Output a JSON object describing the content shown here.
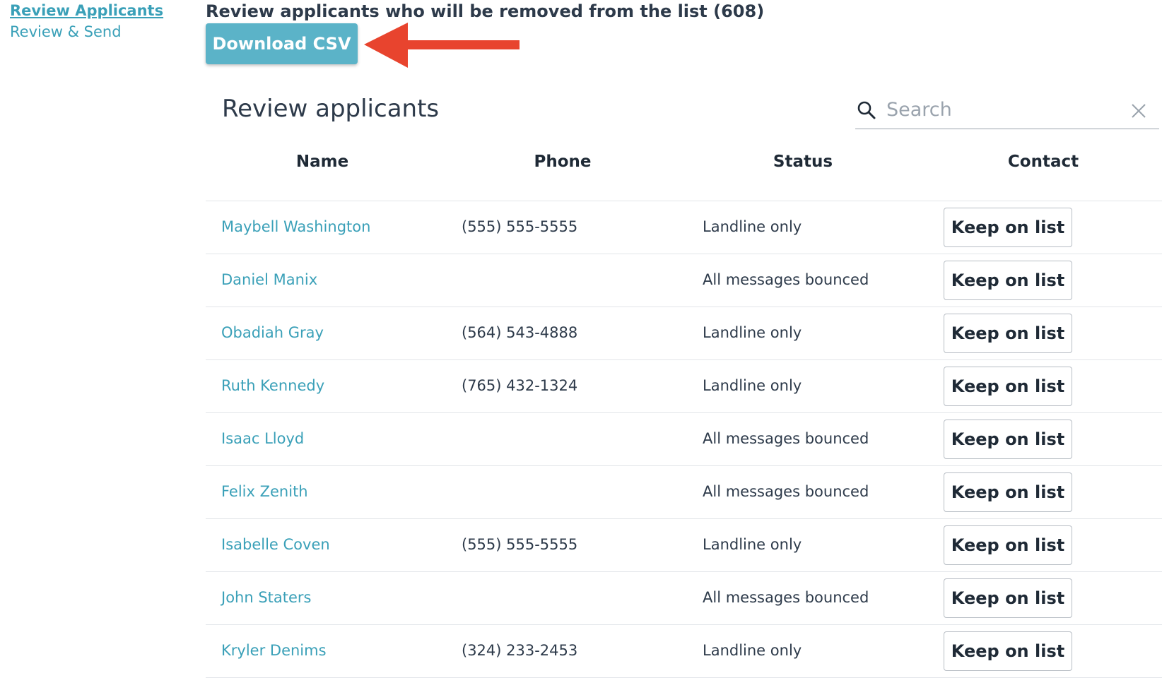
{
  "sidebar": {
    "items": [
      {
        "label": "Review Applicants",
        "active": true
      },
      {
        "label": "Review & Send",
        "active": false
      }
    ]
  },
  "main": {
    "heading": "Review applicants who will be removed from the list (608)",
    "download_button": "Download CSV",
    "panel_title": "Review applicants",
    "search": {
      "placeholder": "Search",
      "value": ""
    },
    "table": {
      "columns": [
        "Name",
        "Phone",
        "Status",
        "Contact"
      ],
      "action_label": "Keep on list",
      "rows": [
        {
          "name": "Maybell Washington",
          "phone": "(555) 555-5555",
          "status": "Landline only"
        },
        {
          "name": "Daniel Manix",
          "phone": "",
          "status": "All messages bounced"
        },
        {
          "name": "Obadiah Gray",
          "phone": "(564) 543-4888",
          "status": "Landline only"
        },
        {
          "name": "Ruth Kennedy",
          "phone": "(765) 432-1324",
          "status": "Landline only"
        },
        {
          "name": "Isaac Lloyd",
          "phone": "",
          "status": "All messages bounced"
        },
        {
          "name": "Felix Zenith",
          "phone": "",
          "status": "All messages bounced"
        },
        {
          "name": "Isabelle Coven",
          "phone": "(555) 555-5555",
          "status": "Landline only"
        },
        {
          "name": "John Staters",
          "phone": "",
          "status": "All messages bounced"
        },
        {
          "name": "Kryler Denims",
          "phone": "(324) 233-2453",
          "status": "Landline only"
        }
      ]
    }
  },
  "colors": {
    "accent": "#3aa0b8",
    "button": "#5bb3c8",
    "arrow": "#e8442e",
    "text": "#2d3a4a"
  },
  "icons": [
    "search-icon",
    "close-icon",
    "arrow-annotation"
  ]
}
